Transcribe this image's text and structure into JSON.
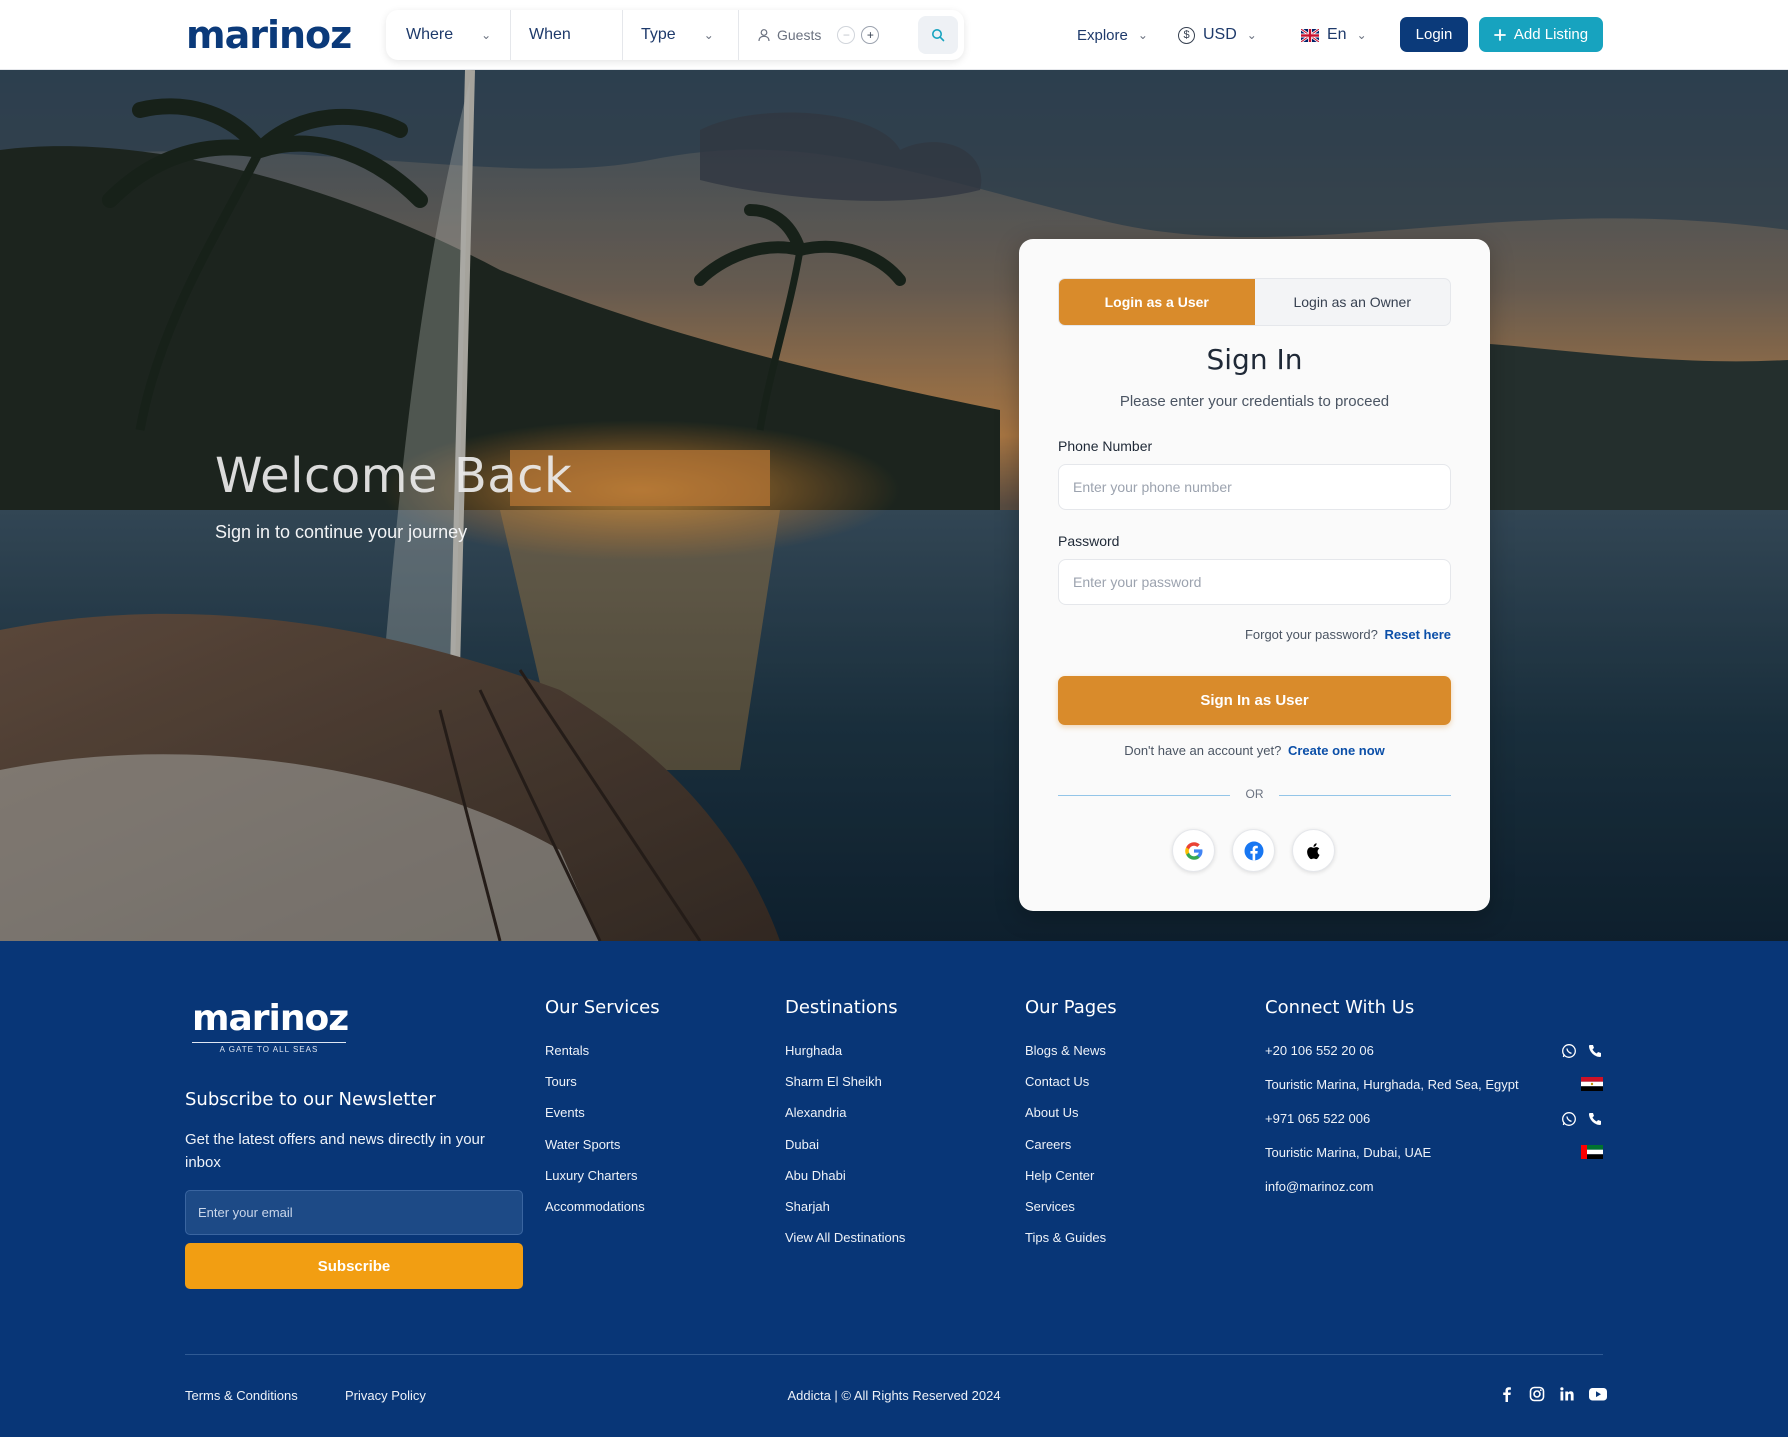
{
  "header": {
    "logo": "marinoz",
    "search": {
      "where_label": "Where",
      "when_label": "When",
      "type_label": "Type",
      "guests_label": "Guests",
      "minus": "−",
      "plus": "+"
    },
    "explore_label": "Explore",
    "currency_symbol": "$",
    "currency_label": "USD",
    "language_label": "En",
    "login_label": "Login",
    "add_listing_label": "Add Listing",
    "colors": {
      "primary": "#0b3a7a",
      "accent": "#17a3bf"
    }
  },
  "hero": {
    "title": "Welcome Back",
    "subtitle": "Sign in to continue your journey"
  },
  "login_card": {
    "tabs": [
      {
        "label": "Login as a User",
        "active": true
      },
      {
        "label": "Login as an Owner",
        "active": false
      }
    ],
    "title": "Sign In",
    "subtitle": "Please enter your credentials to proceed",
    "phone_label": "Phone Number",
    "phone_placeholder": "Enter your phone number",
    "password_label": "Password",
    "password_placeholder": "Enter your password",
    "forgot_text": "Forgot your password?",
    "reset_link": "Reset here",
    "submit_label": "Sign In as User",
    "no_account_text": "Don't have an account yet?",
    "create_link": "Create one now",
    "or_text": "OR",
    "social_icons": [
      "google-icon",
      "facebook-icon",
      "apple-icon"
    ],
    "colors": {
      "button": "#d98b2b",
      "link": "#0b4fa8"
    }
  },
  "footer": {
    "logo": "marinoz",
    "tagline": "A GATE TO ALL SEAS",
    "newsletter_title": "Subscribe to our Newsletter",
    "newsletter_text": "Get the latest offers and news directly in your inbox",
    "email_placeholder": "Enter your email",
    "subscribe_label": "Subscribe",
    "services": {
      "title": "Our Services",
      "items": [
        "Rentals",
        "Tours",
        "Events",
        "Water Sports",
        "Luxury Charters",
        "Accommodations"
      ]
    },
    "destinations": {
      "title": "Destinations",
      "items": [
        "Hurghada",
        "Sharm El Sheikh",
        "Alexandria",
        "Dubai",
        "Abu Dhabi",
        "Sharjah",
        "View All Destinations"
      ]
    },
    "pages": {
      "title": "Our Pages",
      "items": [
        "Blogs & News",
        "Contact Us",
        "About Us",
        "Careers",
        "Help Center",
        "Services",
        "Tips & Guides"
      ]
    },
    "connect": {
      "title": "Connect With Us",
      "phone_egypt": "+20 106 552 20 06",
      "address_egypt": "Touristic Marina, Hurghada, Red Sea, Egypt",
      "phone_uae": "+971 065 522 006",
      "address_uae": "Touristic Marina, Dubai, UAE",
      "email": "info@marinoz.com"
    },
    "terms_label": "Terms & Conditions",
    "privacy_label": "Privacy Policy",
    "copyright": "Addicta | © All Rights Reserved 2024",
    "social_icons": [
      "facebook-icon",
      "instagram-icon",
      "linkedin-icon",
      "youtube-icon"
    ],
    "colors": {
      "background": "#083677",
      "subscribe": "#f29e12"
    }
  }
}
